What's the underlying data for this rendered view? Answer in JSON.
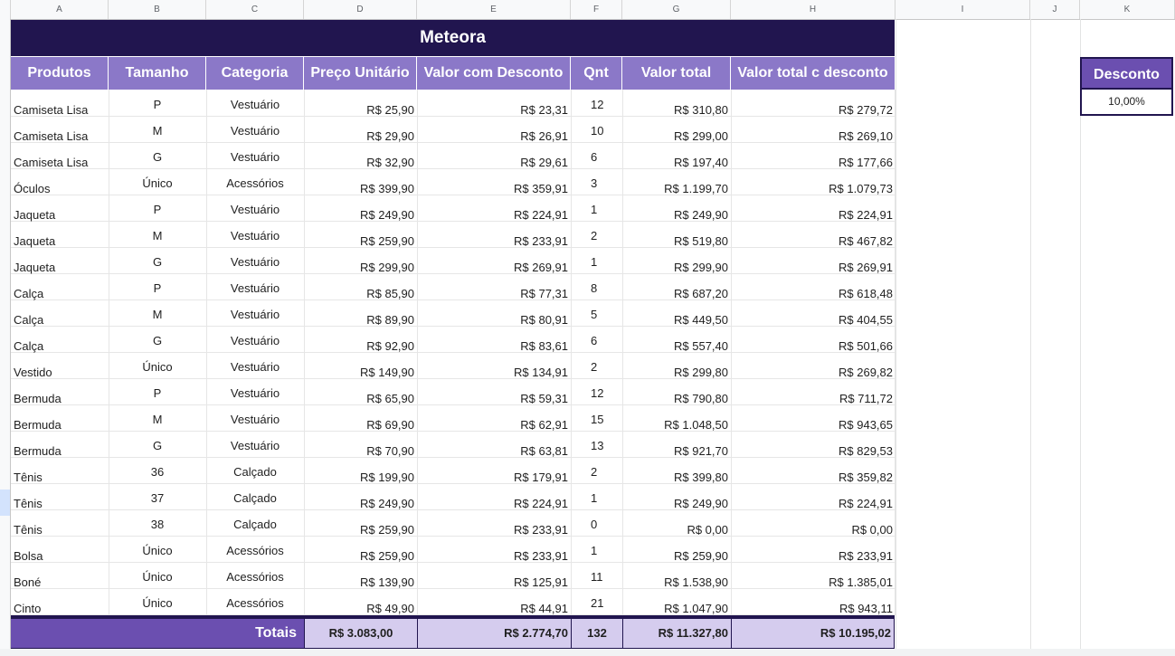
{
  "columns": [
    "A",
    "B",
    "C",
    "D",
    "E",
    "F",
    "G",
    "H",
    "I",
    "J",
    "K"
  ],
  "title": "Meteora",
  "headers": [
    "Produtos",
    "Tamanho",
    "Categoria",
    "Preço Unitário",
    "Valor com Desconto",
    "Qnt",
    "Valor total",
    "Valor total c desconto"
  ],
  "rows": [
    [
      "Camiseta Lisa",
      "P",
      "Vestuário",
      "R$ 25,90",
      "R$ 23,31",
      "12",
      "R$ 310,80",
      "R$ 279,72"
    ],
    [
      "Camiseta Lisa",
      "M",
      "Vestuário",
      "R$ 29,90",
      "R$ 26,91",
      "10",
      "R$ 299,00",
      "R$ 269,10"
    ],
    [
      "Camiseta Lisa",
      "G",
      "Vestuário",
      "R$ 32,90",
      "R$ 29,61",
      "6",
      "R$ 197,40",
      "R$ 177,66"
    ],
    [
      "Óculos",
      "Único",
      "Acessórios",
      "R$ 399,90",
      "R$ 359,91",
      "3",
      "R$ 1.199,70",
      "R$ 1.079,73"
    ],
    [
      "Jaqueta",
      "P",
      "Vestuário",
      "R$ 249,90",
      "R$ 224,91",
      "1",
      "R$ 249,90",
      "R$ 224,91"
    ],
    [
      "Jaqueta",
      "M",
      "Vestuário",
      "R$ 259,90",
      "R$ 233,91",
      "2",
      "R$ 519,80",
      "R$ 467,82"
    ],
    [
      "Jaqueta",
      "G",
      "Vestuário",
      "R$ 299,90",
      "R$ 269,91",
      "1",
      "R$ 299,90",
      "R$ 269,91"
    ],
    [
      "Calça",
      "P",
      "Vestuário",
      "R$ 85,90",
      "R$ 77,31",
      "8",
      "R$ 687,20",
      "R$ 618,48"
    ],
    [
      "Calça",
      "M",
      "Vestuário",
      "R$ 89,90",
      "R$ 80,91",
      "5",
      "R$ 449,50",
      "R$ 404,55"
    ],
    [
      "Calça",
      "G",
      "Vestuário",
      "R$ 92,90",
      "R$ 83,61",
      "6",
      "R$ 557,40",
      "R$ 501,66"
    ],
    [
      "Vestido",
      "Único",
      "Vestuário",
      "R$ 149,90",
      "R$ 134,91",
      "2",
      "R$ 299,80",
      "R$ 269,82"
    ],
    [
      "Bermuda",
      "P",
      "Vestuário",
      "R$ 65,90",
      "R$ 59,31",
      "12",
      "R$ 790,80",
      "R$ 711,72"
    ],
    [
      "Bermuda",
      "M",
      "Vestuário",
      "R$ 69,90",
      "R$ 62,91",
      "15",
      "R$ 1.048,50",
      "R$ 943,65"
    ],
    [
      "Bermuda",
      "G",
      "Vestuário",
      "R$ 70,90",
      "R$ 63,81",
      "13",
      "R$ 921,70",
      "R$ 829,53"
    ],
    [
      "Tênis",
      "36",
      "Calçado",
      "R$ 199,90",
      "R$ 179,91",
      "2",
      "R$ 399,80",
      "R$ 359,82"
    ],
    [
      "Tênis",
      "37",
      "Calçado",
      "R$ 249,90",
      "R$ 224,91",
      "1",
      "R$ 249,90",
      "R$ 224,91"
    ],
    [
      "Tênis",
      "38",
      "Calçado",
      "R$ 259,90",
      "R$ 233,91",
      "0",
      "R$ 0,00",
      "R$ 0,00"
    ],
    [
      "Bolsa",
      "Único",
      "Acessórios",
      "R$ 259,90",
      "R$ 233,91",
      "1",
      "R$ 259,90",
      "R$ 233,91"
    ],
    [
      "Boné",
      "Único",
      "Acessórios",
      "R$ 139,90",
      "R$ 125,91",
      "11",
      "R$ 1.538,90",
      "R$ 1.385,01"
    ],
    [
      "Cinto",
      "Único",
      "Acessórios",
      "R$ 49,90",
      "R$ 44,91",
      "21",
      "R$ 1.047,90",
      "R$ 943,11"
    ]
  ],
  "totals": {
    "label": "Totais",
    "preco": "R$ 3.083,00",
    "valor_desc": "R$ 2.774,70",
    "qnt": "132",
    "valor_total": "R$ 11.327,80",
    "valor_total_desc": "R$ 10.195,02"
  },
  "discount": {
    "label": "Desconto",
    "value": "10,00%"
  },
  "colors": {
    "title_bg": "#21154f",
    "header_bg": "#8b78c8",
    "totals_label_bg": "#6b4fb0",
    "totals_bg": "#d5ccee"
  }
}
